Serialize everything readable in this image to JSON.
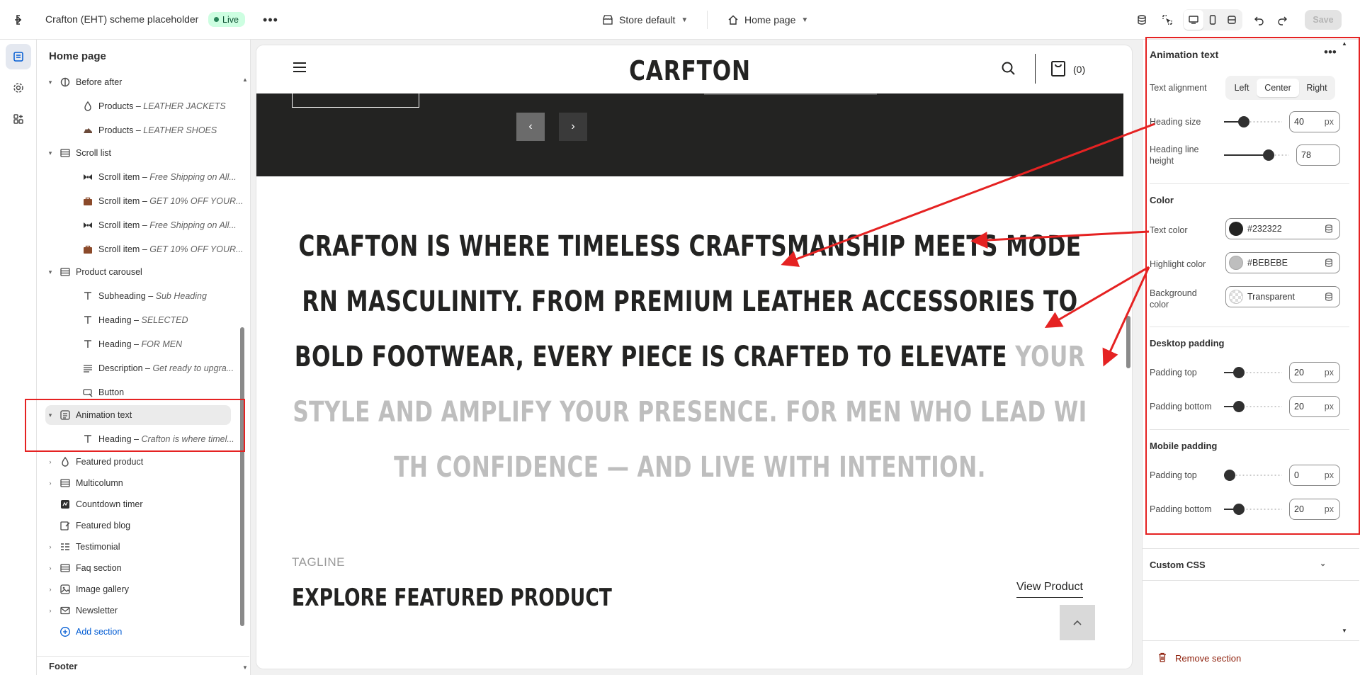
{
  "topbar": {
    "theme_title": "Crafton (EHT) scheme placeholder",
    "live_badge": "Live",
    "store_selector": "Store default",
    "page_selector": "Home page",
    "save_label": "Save"
  },
  "sidebar": {
    "title": "Home page",
    "items": [
      {
        "label": "Before after",
        "sub": ""
      },
      {
        "label": "Products",
        "sub": "LEATHER JACKETS"
      },
      {
        "label": "Products",
        "sub": "LEATHER SHOES"
      },
      {
        "label": "Scroll list",
        "sub": ""
      },
      {
        "label": "Scroll item",
        "sub": "Free Shipping on All..."
      },
      {
        "label": "Scroll item",
        "sub": "GET 10% OFF YOUR..."
      },
      {
        "label": "Scroll item",
        "sub": "Free Shipping on All..."
      },
      {
        "label": "Scroll item",
        "sub": "GET 10% OFF YOUR..."
      },
      {
        "label": "Product carousel",
        "sub": ""
      },
      {
        "label": "Subheading",
        "sub": "Sub Heading"
      },
      {
        "label": "Heading",
        "sub": "SELECTED"
      },
      {
        "label": "Heading",
        "sub": "FOR MEN"
      },
      {
        "label": "Description",
        "sub": "Get ready to upgra..."
      },
      {
        "label": "Button",
        "sub": ""
      },
      {
        "label": "Animation text",
        "sub": ""
      },
      {
        "label": "Heading",
        "sub": "Crafton is where timel..."
      },
      {
        "label": "Featured product",
        "sub": ""
      },
      {
        "label": "Multicolumn",
        "sub": ""
      },
      {
        "label": "Countdown timer",
        "sub": ""
      },
      {
        "label": "Featured blog",
        "sub": ""
      },
      {
        "label": "Testimonial",
        "sub": ""
      },
      {
        "label": "Faq section",
        "sub": ""
      },
      {
        "label": "Image gallery",
        "sub": ""
      },
      {
        "label": "Newsletter",
        "sub": ""
      }
    ],
    "separator": " – ",
    "add_section": "Add section",
    "footer": "Footer"
  },
  "preview": {
    "logo": "CARFTON",
    "cart_count": "(0)",
    "prev_arrow": "‹",
    "next_arrow": "›",
    "animation_text_main": "CRAFTON IS WHERE TIMELESS CRAFTSMANSHIP MEETS MODERN MASCULINITY. FROM PREMIUM LEATHER ACCESSORIES TO BOLD FOOTWEAR, EVERY PIECE IS CRAFTED TO ELEVATE ",
    "animation_text_highlight": "YOUR STYLE AND AMPLIFY YOUR PRESENCE. FOR MEN WHO LEAD WITH CONFIDENCE — AND LIVE WITH INTENTION.",
    "tagline": "TAGLINE",
    "featured_title": "EXPLORE FEATURED PRODUCT",
    "view_product": "View Product"
  },
  "settings": {
    "title": "Animation text",
    "text_alignment_label": "Text alignment",
    "align_left": "Left",
    "align_center": "Center",
    "align_right": "Right",
    "heading_size_label": "Heading size",
    "heading_size_value": "40",
    "heading_line_height_label": "Heading line height",
    "heading_line_height_value": "78",
    "color_section": "Color",
    "text_color_label": "Text color",
    "text_color_value": "#232322",
    "highlight_color_label": "Highlight color",
    "highlight_color_value": "#BEBEBE",
    "background_color_label": "Background color",
    "background_color_value": "Transparent",
    "desktop_padding_section": "Desktop padding",
    "padding_top_label": "Padding top",
    "padding_bottom_label": "Padding bottom",
    "desktop_padding_top": "20",
    "desktop_padding_bottom": "20",
    "mobile_padding_section": "Mobile padding",
    "mobile_padding_top": "0",
    "mobile_padding_bottom": "20",
    "unit": "px",
    "custom_css": "Custom CSS",
    "remove_section": "Remove section"
  },
  "colors": {
    "text_color": "#232322",
    "highlight_color": "#BEBEBE",
    "annotation_red": "#e52222",
    "link_blue": "#005bd3",
    "live_green": "#29845a"
  },
  "levels": {
    "heading_size_fraction": 0.3,
    "line_height_fraction": 0.73,
    "desktop_padding_top_fraction": 0.2,
    "desktop_padding_bottom_fraction": 0.2,
    "mobile_padding_top_fraction": 0.0,
    "mobile_padding_bottom_fraction": 0.2
  },
  "icons": [
    "exit-icon",
    "more-icon",
    "store-icon",
    "home-icon",
    "chevron-down-icon",
    "database-icon",
    "inspector-icon",
    "desktop-icon",
    "mobile-icon",
    "fullwidth-icon",
    "undo-icon",
    "redo-icon",
    "sections-icon",
    "settings-icon",
    "apps-icon",
    "search-icon",
    "cart-icon",
    "trash-icon"
  ]
}
